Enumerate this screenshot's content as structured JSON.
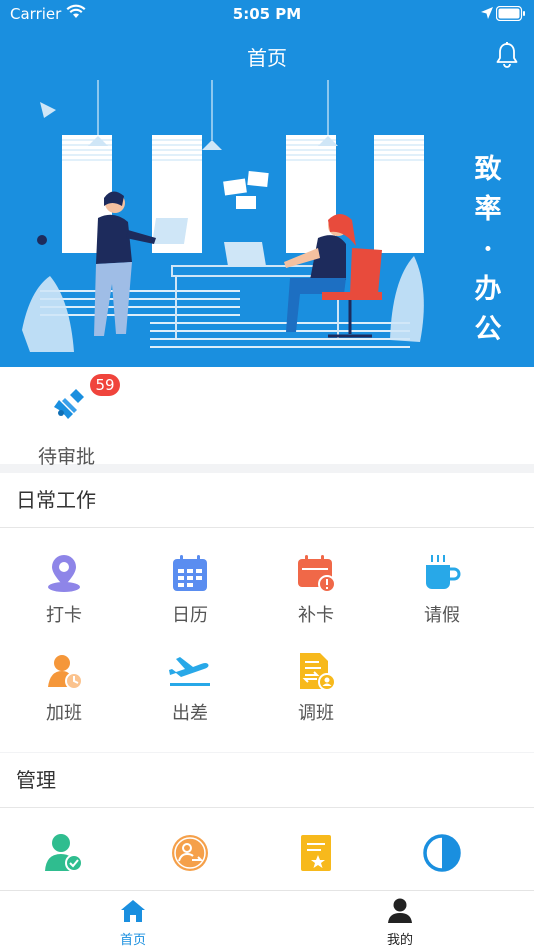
{
  "status": {
    "carrier": "Carrier",
    "time": "5:05 PM"
  },
  "nav": {
    "title": "首页"
  },
  "banner": {
    "slogan_chars": [
      "致",
      "率",
      "·",
      "办",
      "公"
    ]
  },
  "approval": {
    "label": "待审批",
    "badge": "59"
  },
  "daily": {
    "title": "日常工作",
    "items": [
      {
        "label": "打卡",
        "icon": "location-pin-icon"
      },
      {
        "label": "日历",
        "icon": "calendar-icon"
      },
      {
        "label": "补卡",
        "icon": "calendar-alert-icon"
      },
      {
        "label": "请假",
        "icon": "coffee-cup-icon"
      },
      {
        "label": "加班",
        "icon": "person-clock-icon"
      },
      {
        "label": "出差",
        "icon": "airplane-icon"
      },
      {
        "label": "调班",
        "icon": "document-swap-icon"
      }
    ]
  },
  "manage": {
    "title": "管理",
    "items": [
      {
        "icon": "person-check-icon"
      },
      {
        "icon": "person-transfer-icon"
      },
      {
        "icon": "document-star-icon"
      },
      {
        "icon": "contrast-icon"
      }
    ]
  },
  "tabs": [
    {
      "label": "首页",
      "icon": "home-icon",
      "active": true
    },
    {
      "label": "我的",
      "icon": "profile-icon",
      "active": false
    }
  ],
  "colors": {
    "primary": "#1a8fdf",
    "badge": "#f0443c",
    "orange": "#f5973a",
    "yellow": "#f7b91c",
    "green": "#2fbd8f"
  }
}
